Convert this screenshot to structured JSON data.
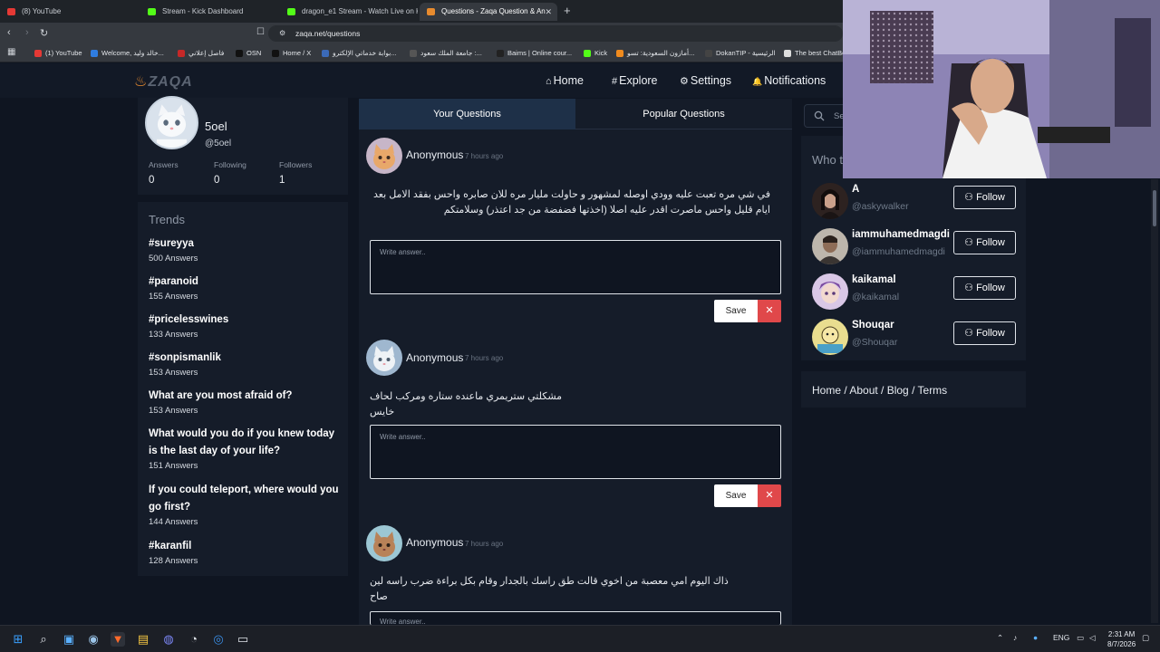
{
  "browser": {
    "tabs": [
      {
        "label": "(8) YouTube",
        "color": "#e53935"
      },
      {
        "label": "Stream - Kick Dashboard",
        "color": "#53fc18"
      },
      {
        "label": "dragon_e1 Stream - Watch Live on K",
        "color": "#53fc18"
      },
      {
        "label": "Questions - Zaqa Question & An",
        "color": "#e88b2e"
      }
    ],
    "url": "zaqa.net/questions",
    "bookmarks": [
      {
        "label": "(1) YouTube",
        "color": "#e53935"
      },
      {
        "label": "Welcome, خالد وليد...",
        "color": "#2f7de1"
      },
      {
        "label": "فاصل إعلاني",
        "color": "#c62828"
      },
      {
        "label": "OSN",
        "color": "#111111"
      },
      {
        "label": "Home / X",
        "color": "#111111"
      },
      {
        "label": "بوابة خدماتي الإلكترو...",
        "color": "#3b6ab8"
      },
      {
        "label": "جامعة الملك سعود :...",
        "color": "#555555"
      },
      {
        "label": "Baims | Online cour...",
        "color": "#222222"
      },
      {
        "label": "Kick",
        "color": "#53fc18"
      },
      {
        "label": "أمازون السعودية: تسو...",
        "color": "#f08b1e"
      },
      {
        "label": "DokanTIP - الرئيسية",
        "color": "#444444"
      },
      {
        "label": "The best ChatBo",
        "color": "#dddddd"
      }
    ]
  },
  "site": {
    "logo": "ZAQA",
    "nav": {
      "home": "Home",
      "explore": "Explore",
      "settings": "Settings",
      "notifications": "Notifications"
    },
    "icons": {
      "home": "⌂",
      "explore": "#",
      "settings": "⚙",
      "notifications": "🔔"
    }
  },
  "profile": {
    "name": "5oel",
    "handle": "@5oel",
    "stats": [
      {
        "label": "Answers",
        "value": "0"
      },
      {
        "label": "Following",
        "value": "0"
      },
      {
        "label": "Followers",
        "value": "1"
      }
    ]
  },
  "trends": {
    "title": "Trends",
    "items": [
      {
        "tag": "#sureyya",
        "count": "500 Answers"
      },
      {
        "tag": "#paranoid",
        "count": "155 Answers"
      },
      {
        "tag": "#pricelesswines",
        "count": "133 Answers"
      },
      {
        "tag": "#sonpismanlik",
        "count": "153 Answers"
      },
      {
        "tag": "What are you most afraid of?",
        "count": "153 Answers"
      },
      {
        "tag": "What would you do if you knew today is the last day of your life?",
        "count": "151 Answers"
      },
      {
        "tag": "If you could teleport, where would you go first?",
        "count": "144 Answers"
      },
      {
        "tag": "#karanfil",
        "count": "128 Answers"
      }
    ]
  },
  "tabs": {
    "yours": "Your Questions",
    "popular": "Popular Questions"
  },
  "questions": [
    {
      "author": "Anonymous",
      "time": "7 hours ago",
      "text": "في شي مره تعبت عليه وودي اوصله لمشهور و حاولت مليار مره للان صابره واحس بفقد الامل بعد ايام قليل واحس ماصرت اقدر عليه اصلا (اخذتها فضفضة من جد اعتذر) وسلامتكم",
      "placeholder": "Write answer..",
      "save": "Save",
      "cancel": "✕"
    },
    {
      "author": "Anonymous",
      "time": "7 hours ago",
      "text": "مشكلتي ستريمري ماعنده ستاره ومركب لحاف خايس",
      "placeholder": "Write answer..",
      "save": "Save",
      "cancel": "✕"
    },
    {
      "author": "Anonymous",
      "time": "7 hours ago",
      "text": "ذاك اليوم امي معصبة من اخوي قالت طق راسك بالجدار وقام بكل براءة ضرب راسه لين صاح",
      "placeholder": "Write answer.."
    }
  ],
  "sidebar": {
    "search_placeholder": "Se",
    "who_to_follow": "Who to",
    "follow_label": "Follow",
    "users": [
      {
        "name": "A",
        "handle": "@askywalker"
      },
      {
        "name": "iammuhamedmagdi",
        "handle": "@iammuhamedmagdi"
      },
      {
        "name": "kaikamal",
        "handle": "@kaikamal"
      },
      {
        "name": "Shouqar",
        "handle": "@Shouqar"
      }
    ],
    "footer": "Home / About / Blog / Terms"
  },
  "taskbar": {
    "lang": "ENG",
    "time": "2:31 AM",
    "date": "8/7/2026"
  }
}
